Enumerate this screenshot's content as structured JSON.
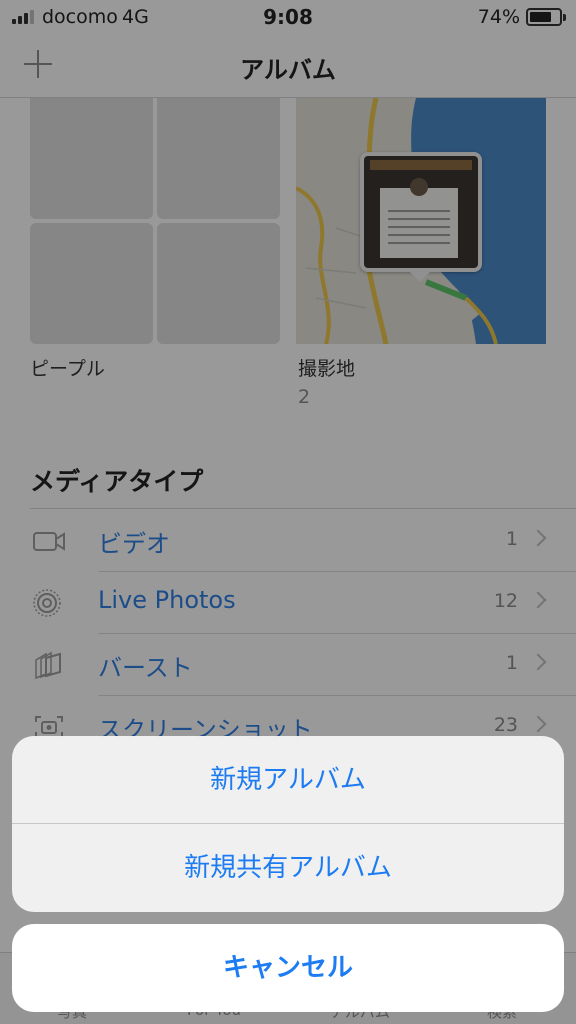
{
  "status_bar": {
    "carrier": "docomo",
    "network": "4G",
    "time": "9:08",
    "battery_percent": "74%",
    "battery_level": 0.74
  },
  "nav": {
    "title": "アルバム",
    "add_icon": "plus-icon"
  },
  "albums": {
    "people": {
      "label": "ピープル"
    },
    "places": {
      "label": "撮影地",
      "count": "2"
    }
  },
  "media_types": {
    "title": "メディアタイプ",
    "items": [
      {
        "label": "ビデオ",
        "count": "1",
        "icon": "video-camera-icon"
      },
      {
        "label": "Live Photos",
        "count": "12",
        "icon": "live-photos-icon"
      },
      {
        "label": "バースト",
        "count": "1",
        "icon": "burst-icon"
      },
      {
        "label": "スクリーンショット",
        "count": "23",
        "icon": "screenshot-icon"
      }
    ]
  },
  "tab_bar": {
    "tabs": [
      {
        "label": "写真"
      },
      {
        "label": "For You"
      },
      {
        "label": "アルバム"
      },
      {
        "label": "検索"
      }
    ]
  },
  "action_sheet": {
    "new_album": "新規アルバム",
    "new_shared_album": "新規共有アルバム",
    "cancel": "キャンセル"
  },
  "colors": {
    "accent": "#1d7cf2",
    "link_text": "#2f7ddc",
    "overlay": "rgba(0,0,0,0.38)"
  }
}
